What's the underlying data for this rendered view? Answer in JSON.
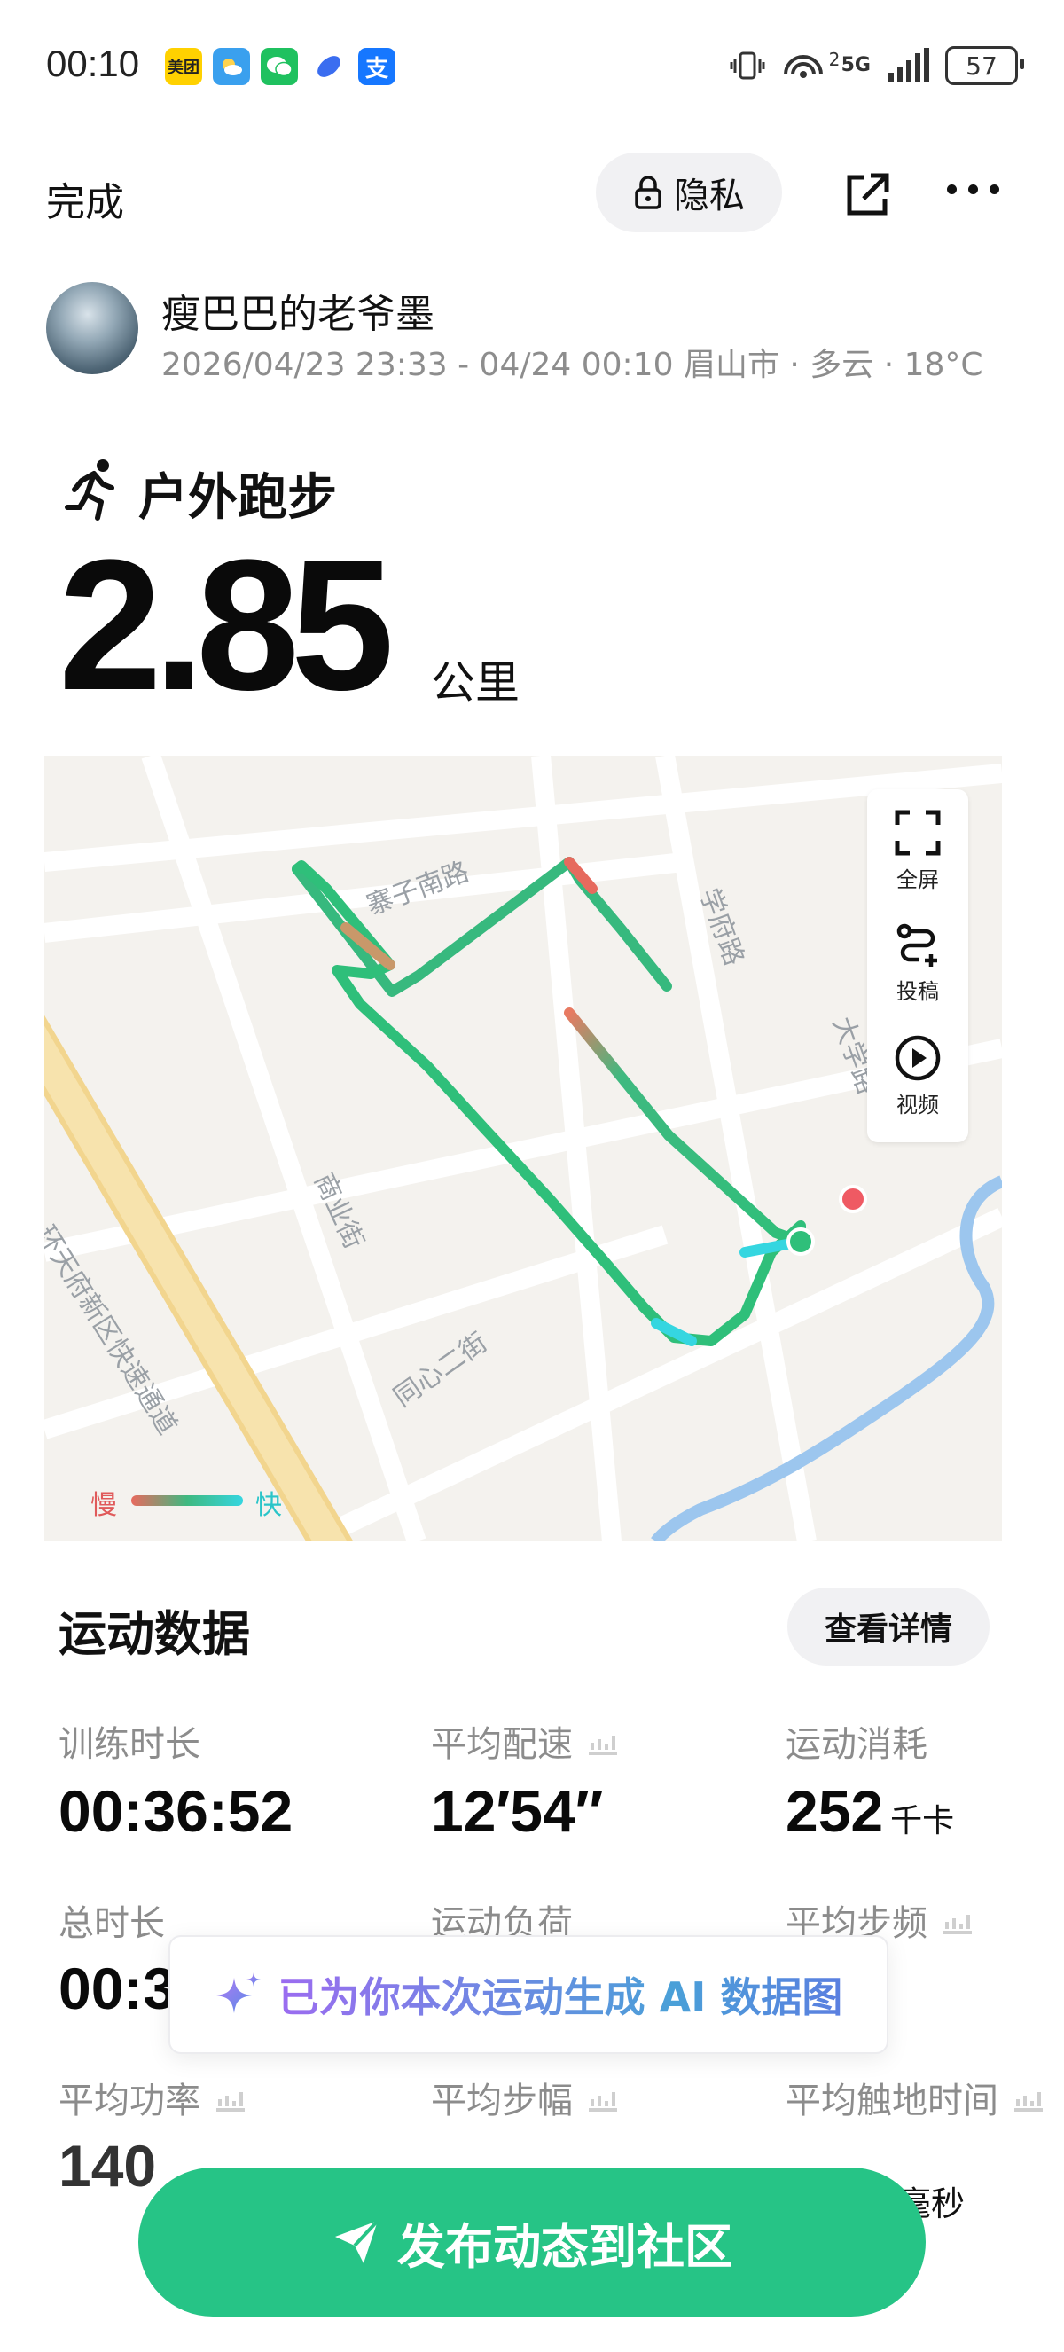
{
  "status_bar": {
    "time": "00:10",
    "apps": [
      {
        "name": "meituan-icon",
        "label": "美团",
        "color": "#ffd100"
      },
      {
        "name": "weather-icon",
        "label": "",
        "color": "#3aa0ee"
      },
      {
        "name": "wechat-icon",
        "label": "",
        "color": "#1fc15f"
      },
      {
        "name": "browser-icon",
        "label": "",
        "color": "#3a6df0"
      },
      {
        "name": "alipay-icon",
        "label": "支",
        "color": "#1677ff"
      }
    ],
    "network": "5G",
    "sim": "2",
    "battery": "57"
  },
  "header": {
    "done_label": "完成",
    "privacy_label": "隐私"
  },
  "user": {
    "name": "瘦巴巴的老爷墨",
    "meta": "2026/04/23 23:33 - 04/24 00:10 眉山市 · 多云 · 18°C"
  },
  "sport": {
    "name": "户外跑步",
    "distance": "2.85",
    "unit": "公里"
  },
  "map": {
    "streets": [
      "寨子南路",
      "学府路",
      "大学路",
      "商业街",
      "同心二街",
      "环天府新区快速通道"
    ],
    "tools": [
      {
        "icon": "fullscreen-icon",
        "label": "全屏"
      },
      {
        "icon": "route-submit-icon",
        "label": "投稿"
      },
      {
        "icon": "video-play-icon",
        "label": "视频"
      }
    ],
    "legend_slow": "慢",
    "legend_fast": "快"
  },
  "stats": {
    "title": "运动数据",
    "details_label": "查看详情",
    "items": [
      {
        "label": "训练时长",
        "value": "00:36:52",
        "unit": ""
      },
      {
        "label": "平均配速",
        "value": "12′54″",
        "unit": ""
      },
      {
        "label": "运动消耗",
        "value": "252",
        "unit": "千卡"
      },
      {
        "label": "总时长",
        "value": "00:3",
        "unit": ""
      },
      {
        "label": "运动负荷",
        "value": "",
        "unit": ""
      },
      {
        "label": "平均步频",
        "value": "",
        "unit": ""
      },
      {
        "label": "平均功率",
        "value": "140",
        "unit": ""
      },
      {
        "label": "平均步幅",
        "value": "",
        "unit": ""
      },
      {
        "label": "平均触地时间",
        "value": "",
        "unit": "毫秒"
      }
    ]
  },
  "ai_banner": {
    "text": "已为你本次运动生成 AI 数据图"
  },
  "publish": {
    "label": "发布动态到社区"
  },
  "colors": {
    "accent": "#26c486",
    "route_slow": "#e86a5e",
    "route_mid": "#3fb980",
    "route_fast": "#35d6e0"
  }
}
